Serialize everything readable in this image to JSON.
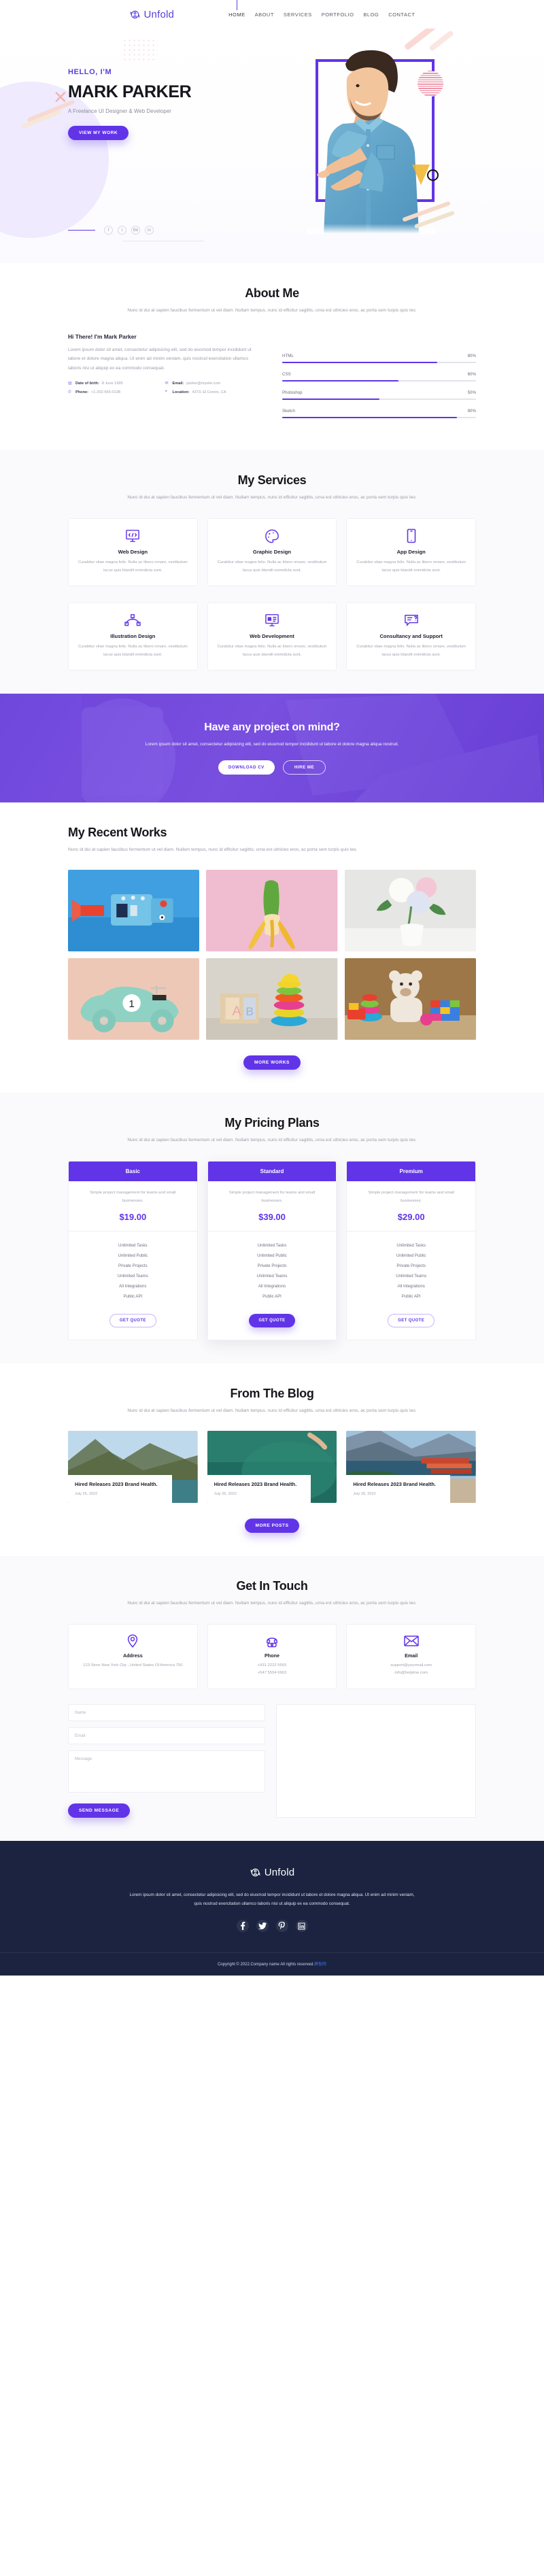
{
  "brand": {
    "name": "Unfold",
    "logo_icon": "unfold-user-cycle-icon"
  },
  "nav": {
    "items": [
      {
        "label": "HOME",
        "active": true
      },
      {
        "label": "ABOUT",
        "active": false
      },
      {
        "label": "SERVICES",
        "active": false
      },
      {
        "label": "PORTFOLIO",
        "active": false
      },
      {
        "label": "BLOG",
        "active": false
      },
      {
        "label": "CONTACT",
        "active": false
      }
    ]
  },
  "hero": {
    "eyebrow": "HELLO, I'M",
    "name": "MARK PARKER",
    "subtitle": "A Freelance UI Designer & Web Developer",
    "cta_label": "VIEW MY WORK",
    "socials": [
      {
        "name": "facebook-icon",
        "glyph": "f"
      },
      {
        "name": "twitter-icon",
        "glyph": "t"
      },
      {
        "name": "behance-icon",
        "glyph": "Bē"
      },
      {
        "name": "linkedin-icon",
        "glyph": "in"
      }
    ]
  },
  "about": {
    "title": "About Me",
    "subtitle": "Nunc id dui at sapien faucibus fermentum ut vel diam. Nullam tempus, nunc id efficitur sagittis, urna est ultricies eros, ac porta sem turpis quis leo.",
    "heading": "Hi There! I'm Mark Parker",
    "paragraph": "Lorem ipsum dolor sit amet, consectetur adipisicing elit, sed do eiusmod tempor incididunt ut labore et dolore magna aliqua. Ut enim ad minim veniam, quis nostrud exercitation ullamco laboris nisi ut aliquip ex ea commodo consequat.",
    "meta": [
      {
        "icon": "calendar-icon",
        "key": "Date of birth:",
        "value": "8 June 1995"
      },
      {
        "icon": "mail-icon",
        "key": "Email:",
        "value": "parker@mysite.com"
      },
      {
        "icon": "phone-icon",
        "key": "Phone:",
        "value": "+1-202-555-0138"
      },
      {
        "icon": "location-icon",
        "key": "Location:",
        "value": "4373, El Centro, CA"
      }
    ],
    "skills": [
      {
        "label": "HTML",
        "value": "80%",
        "pct": 80
      },
      {
        "label": "CSS",
        "value": "60%",
        "pct": 60
      },
      {
        "label": "Photoshop",
        "value": "50%",
        "pct": 50
      },
      {
        "label": "Sketch",
        "value": "90%",
        "pct": 90
      }
    ]
  },
  "services": {
    "title": "My Services",
    "subtitle": "Nunc id dui at sapien faucibus fermentum ut vel diam. Nullam tempus, nunc id efficitur sagittis, urna est ultricies eros, ac porta sem turpis quis leo.",
    "card_desc": "Curabitur vitae magna felis. Nulla ac libero ornare, vestibulum lacus quis blandit enimdicta sunt.",
    "items": [
      {
        "title": "Web Design",
        "icon": "code-monitor-icon"
      },
      {
        "title": "Graphic Design",
        "icon": "palette-icon"
      },
      {
        "title": "App Design",
        "icon": "mobile-phone-icon"
      },
      {
        "title": "Illustration Design",
        "icon": "bezier-pen-icon"
      },
      {
        "title": "Web Development",
        "icon": "browser-layout-icon"
      },
      {
        "title": "Consultancy and Support",
        "icon": "chat-question-icon"
      }
    ]
  },
  "cta": {
    "title": "Have any project on mind?",
    "text": "Lorem ipsum dolor sit amet, consectetur adipisicing elit, sed do eiusmod tempor incididunt ut labore et dolore magna aliqua nostrud.",
    "primary_label": "DOWNLOAD CV",
    "secondary_label": "HIRE ME"
  },
  "works": {
    "title": "My Recent Works",
    "subtitle": "Nunc id dui at sapien faucibus fermentum ut vel diam. Nullam tempus, nunc id efficitur sagittis, urna est ultricies eros, ac porta sem turpis quis leo.",
    "button_label": "MORE WORKS",
    "items": [
      {
        "name": "blue-tin-robot-toy-photo"
      },
      {
        "name": "peeled-banana-cactus-photo"
      },
      {
        "name": "white-vase-hydrangea-photo"
      },
      {
        "name": "mint-toy-race-car-photo"
      },
      {
        "name": "abc-blocks-ring-stacker-photo"
      },
      {
        "name": "teddy-bear-toys-pile-photo"
      }
    ]
  },
  "pricing": {
    "title": "My Pricing Plans",
    "subtitle": "Nunc id dui at sapien faucibus fermentum ut vel diam. Nullam tempus, nunc id efficitur sagittis, urna est ultricies eros, ac porta sem turpis quis leo.",
    "plan_desc": "Simple project management for teams and small businesses.",
    "features": [
      "Unlimited Tasks",
      "Unlimited Public",
      "Private Projects",
      "Unlimited Teams",
      "All Integrations",
      "Public API"
    ],
    "button_label": "GET QUOTE",
    "plans": [
      {
        "name": "Basic",
        "price": "$19.00",
        "featured": false
      },
      {
        "name": "Standard",
        "price": "$39.00",
        "featured": true
      },
      {
        "name": "Premium",
        "price": "$29.00",
        "featured": false
      }
    ]
  },
  "blog": {
    "title": "From The Blog",
    "subtitle": "Nunc id dui at sapien faucibus fermentum ut vel diam. Nullam tempus, nunc id efficitur sagittis, urna est ultricies eros, ac porta sem turpis quis leo.",
    "button_label": "MORE POSTS",
    "posts": [
      {
        "title": "Hired Releases 2023 Brand Health.",
        "date": "July 26, 2022",
        "image": "mountain-lake-kayak-photo"
      },
      {
        "title": "Hired Releases 2023 Brand Health.",
        "date": "July 26, 2022",
        "image": "aerial-green-water-swimmer-photo"
      },
      {
        "title": "Hired Releases 2023 Brand Health.",
        "date": "July 26, 2022",
        "image": "canoes-alpine-lake-photo"
      }
    ]
  },
  "contact": {
    "title": "Get In Touch",
    "subtitle": "Nunc id dui at sapien faucibus fermentum ut vel diam. Nullam tempus, nunc id efficitur sagittis, urna est ultricies eros, ac porta sem turpis quis leo.",
    "cards": [
      {
        "icon": "location-pin-icon",
        "heading": "Address",
        "value": "123 Stree New York City , United States Of America 750"
      },
      {
        "icon": "telephone-icon",
        "heading": "Phone",
        "value": "+931 2222 5555\n+547 5554 6663"
      },
      {
        "icon": "envelope-icon",
        "heading": "Email",
        "value": "support@yourmail.com\ninfo@helpline.com"
      }
    ],
    "form": {
      "name_placeholder": "Name",
      "email_placeholder": "Email",
      "message_placeholder": "Message",
      "submit_label": "SEND MESSAGE",
      "name_value": "",
      "email_value": "",
      "message_value": ""
    }
  },
  "footer": {
    "brand": "Unfold",
    "text": "Lorem ipsum dolor sit amet, consectetur adipisicing elit, sed do eiusmod tempor incididunt ut labore et dolore magna aliqua. Ut enim ad minim veniam, quis nostrud exercitation ullamco laboris nisi ut aliquip ex ea commodo consequat.",
    "socials": [
      {
        "name": "facebook-icon"
      },
      {
        "name": "twitter-icon"
      },
      {
        "name": "pinterest-icon"
      },
      {
        "name": "linkedin-icon"
      }
    ],
    "copyright": "Copyright © 2022.Company name All rights reserved.",
    "copyright_suffix": "模板网"
  },
  "colors": {
    "accent": "#6134e8",
    "accent_light": "#7b4fe6",
    "footer_bg": "#1b2340",
    "muted_text": "#9a9aa8",
    "tint_bg": "#fafafc"
  }
}
